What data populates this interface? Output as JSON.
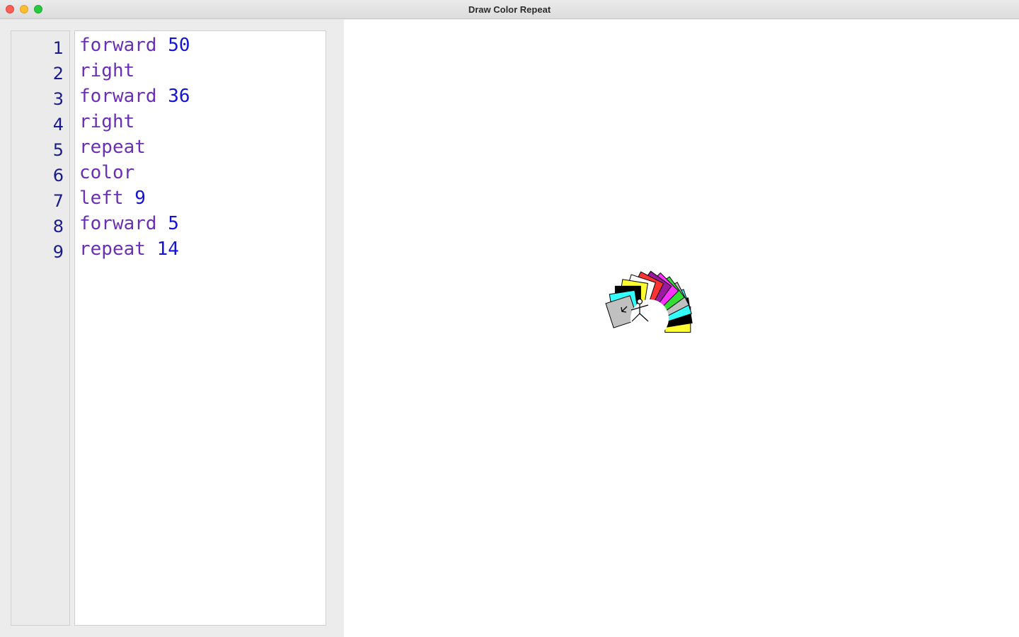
{
  "window": {
    "title": "Draw Color Repeat"
  },
  "editor": {
    "line_numbers": [
      "1",
      "2",
      "3",
      "4",
      "5",
      "6",
      "7",
      "8",
      "9"
    ],
    "lines": [
      {
        "keyword": "forward",
        "arg": "50"
      },
      {
        "keyword": "right",
        "arg": ""
      },
      {
        "keyword": "forward",
        "arg": "36"
      },
      {
        "keyword": "right",
        "arg": ""
      },
      {
        "keyword": "repeat",
        "arg": ""
      },
      {
        "keyword": "color",
        "arg": ""
      },
      {
        "keyword": "left",
        "arg": "9"
      },
      {
        "keyword": "forward",
        "arg": "5"
      },
      {
        "keyword": "repeat",
        "arg": "14"
      }
    ]
  },
  "colors": {
    "keyword": "#6a2fb5",
    "number": "#1414d6",
    "line_number": "#1a1a8a",
    "palette": [
      "#ffff33",
      "#000000",
      "#33ffff",
      "#c0c0c0",
      "#33dd33",
      "#ff33ff",
      "#9a1aa0",
      "#ff3333",
      "#ffffff",
      "#ffff33",
      "#000000",
      "#33ffff",
      "#c0c0c0"
    ]
  },
  "turtle": {
    "icon": "stick-figure-icon"
  }
}
